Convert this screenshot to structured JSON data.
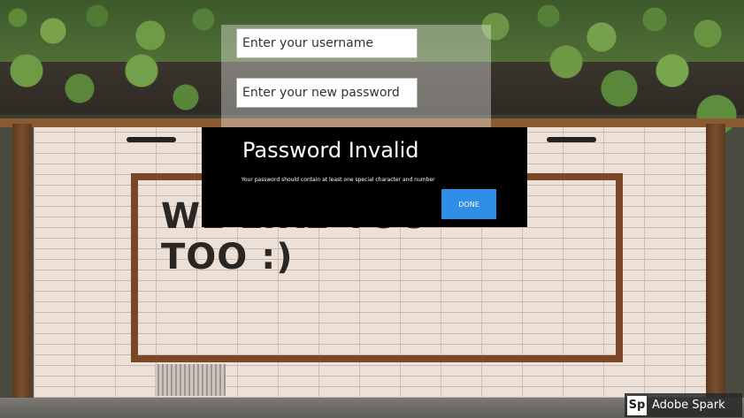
{
  "background": {
    "mural_line1": "WE LIKE YOU",
    "mural_line2": "TOO :)"
  },
  "form": {
    "username_placeholder": "Enter your username",
    "password_placeholder": "Enter your new password"
  },
  "dialog": {
    "title": "Password Invalid",
    "message": "Your password should contain at least one special character and number",
    "done_label": "DONE"
  },
  "watermark": {
    "logo": "Sp",
    "text": "Adobe Spark"
  },
  "colors": {
    "dialog_bg": "#000000",
    "button_accent": "#2f8fe6"
  }
}
